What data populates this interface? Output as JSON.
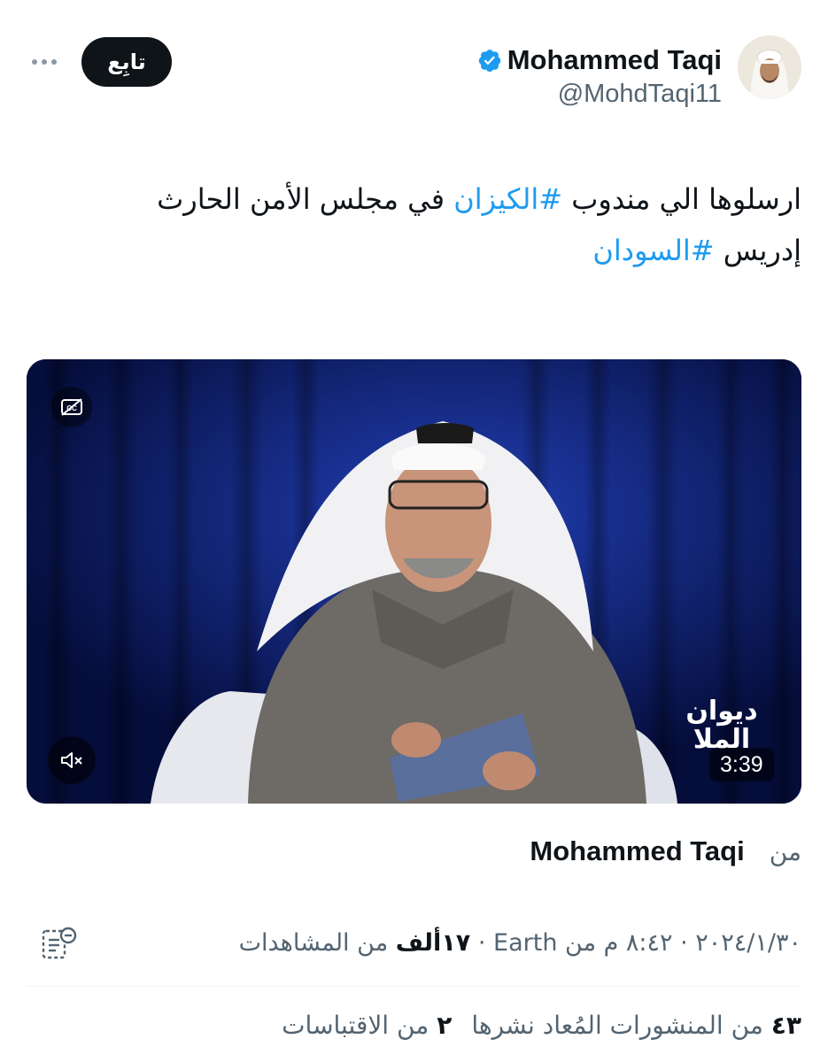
{
  "author": {
    "display_name": "Mohammed Taqi",
    "handle": "@MohdTaqi11",
    "verified_icon": "verified-badge-icon",
    "avatar_icon": "avatar"
  },
  "actions": {
    "follow_label": "تابِع",
    "more_icon": "more-options-icon"
  },
  "tweet": {
    "text_part1": "ارسلوها الي مندوب ",
    "hashtag1": "#الكيزان",
    "text_part2": " في مجلس الأمن الحارث إدريس ",
    "hashtag2": "#السودان"
  },
  "video": {
    "duration": "3:39",
    "cc_icon": "captions-off-icon",
    "mute_icon": "muted-speaker-icon",
    "logo_line1": "ديوان",
    "logo_line2": "الملا"
  },
  "source": {
    "label": "من",
    "name": "Mohammed Taqi"
  },
  "meta": {
    "date": "٢٠٢٤/١/٣٠",
    "sep1": " · ",
    "time": "٨:٤٢ م من Earth",
    "sep2": " · ",
    "views_count": "١٧ألف",
    "views_label": " من المشاهدات"
  },
  "stats": {
    "reposts_count": "٤٣",
    "reposts_label": "من المنشورات المُعاد نشرها",
    "quotes_count": "٢",
    "quotes_label": "من الاقتباسات"
  },
  "colors": {
    "accent": "#1d9bf0",
    "text_primary": "#0f1419",
    "text_secondary": "#536471",
    "video_bg": "#0a1a5e"
  }
}
